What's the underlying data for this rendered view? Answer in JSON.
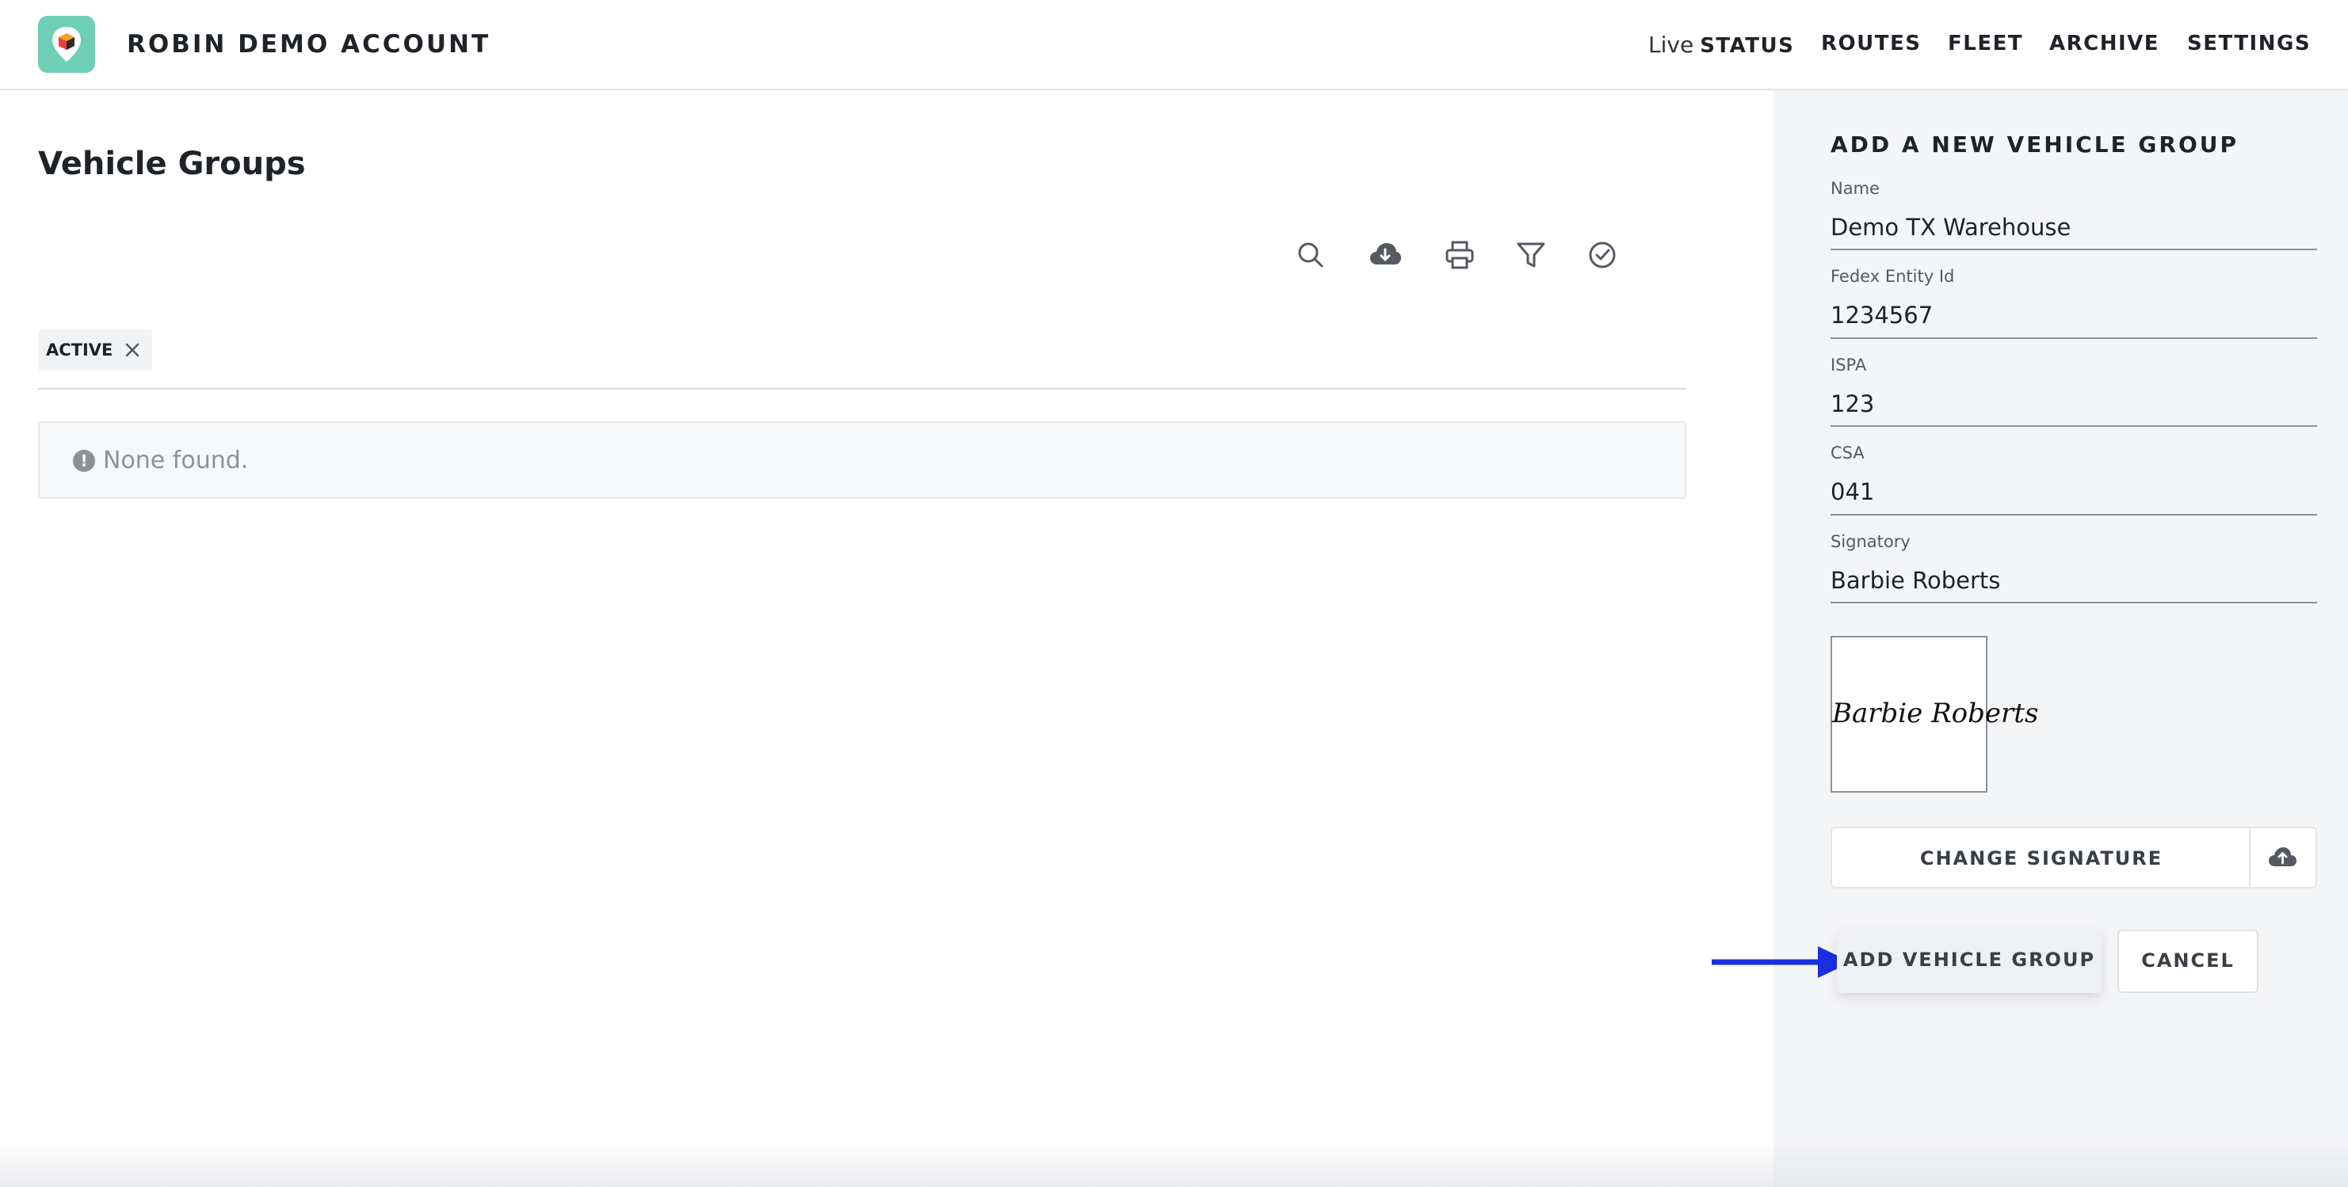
{
  "header": {
    "account_name": "ROBIN DEMO ACCOUNT",
    "nav": {
      "live_prefix": "Live",
      "status": "STATUS",
      "routes": "ROUTES",
      "fleet": "FLEET",
      "archive": "ARCHIVE",
      "settings": "SETTINGS"
    }
  },
  "main": {
    "title": "Vehicle Groups",
    "toolbar_icons": [
      "search-icon",
      "cloud-download-icon",
      "print-icon",
      "filter-icon",
      "check-circle-icon"
    ],
    "filter_chip": "ACTIVE",
    "empty_message": "None found."
  },
  "panel": {
    "title": "ADD A NEW VEHICLE GROUP",
    "fields": [
      {
        "label": "Name",
        "value": "Demo TX Warehouse"
      },
      {
        "label": "Fedex Entity Id",
        "value": "1234567"
      },
      {
        "label": "ISPA",
        "value": "123"
      },
      {
        "label": "CSA",
        "value": "041"
      },
      {
        "label": "Signatory",
        "value": "Barbie Roberts"
      }
    ],
    "signature_image_text": "Barbie Roberts",
    "change_signature_label": "CHANGE SIGNATURE",
    "add_button_label": "ADD VEHICLE GROUP",
    "cancel_button_label": "CANCEL"
  },
  "colors": {
    "logo_bg": "#6fcfb4",
    "panel_bg": "#f4f5f7",
    "arrow": "#1a2fe0",
    "muted_text": "#8e9196"
  }
}
